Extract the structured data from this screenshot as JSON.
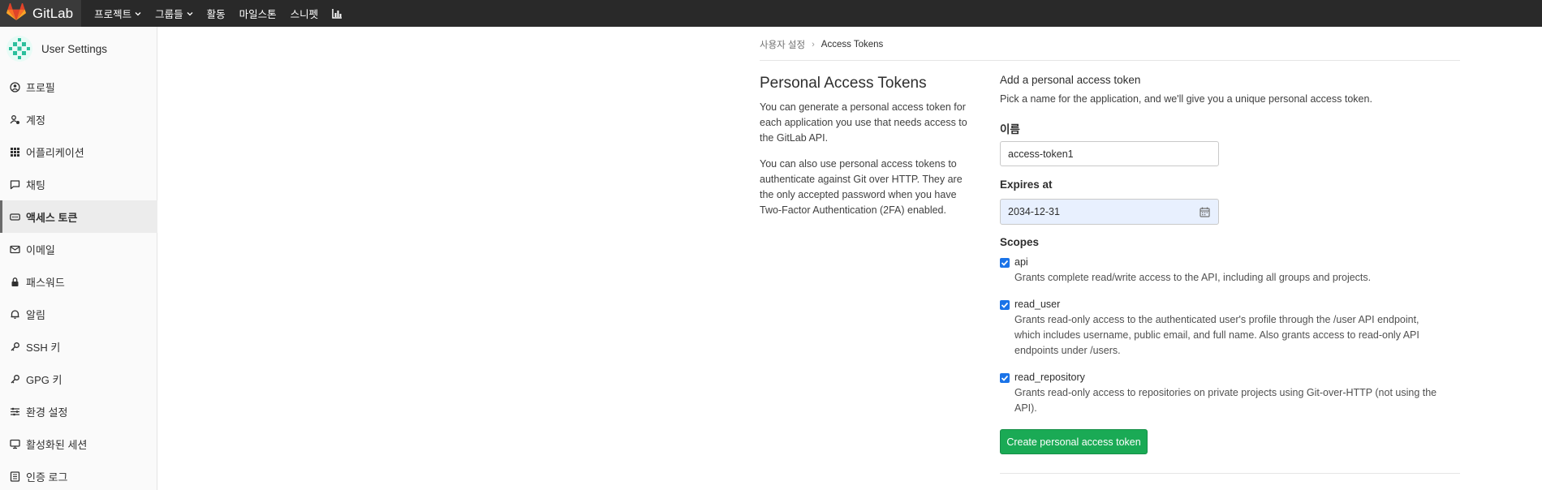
{
  "navbar": {
    "brand": "GitLab",
    "items": [
      {
        "label": "프로젝트",
        "dropdown": true
      },
      {
        "label": "그룹들",
        "dropdown": true
      },
      {
        "label": "활동",
        "dropdown": false
      },
      {
        "label": "마일스톤",
        "dropdown": false
      },
      {
        "label": "스니펫",
        "dropdown": false
      }
    ],
    "chart_icon": "chart-icon"
  },
  "sidebar": {
    "title": "User Settings",
    "items": [
      {
        "label": "프로필",
        "icon": "profile-icon"
      },
      {
        "label": "계정",
        "icon": "account-icon"
      },
      {
        "label": "어플리케이션",
        "icon": "applications-icon"
      },
      {
        "label": "채팅",
        "icon": "chat-icon"
      },
      {
        "label": "액세스 토큰",
        "icon": "token-icon",
        "active": true
      },
      {
        "label": "이메일",
        "icon": "email-icon"
      },
      {
        "label": "패스워드",
        "icon": "lock-icon"
      },
      {
        "label": "알림",
        "icon": "bell-icon"
      },
      {
        "label": "SSH 키",
        "icon": "key-icon"
      },
      {
        "label": "GPG 키",
        "icon": "key-icon"
      },
      {
        "label": "환경 설정",
        "icon": "preferences-icon"
      },
      {
        "label": "활성화된 세션",
        "icon": "monitor-icon"
      },
      {
        "label": "인증 로그",
        "icon": "log-icon"
      }
    ]
  },
  "breadcrumb": {
    "parent": "사용자 설정",
    "separator": "›",
    "current": "Access Tokens"
  },
  "intro": {
    "title": "Personal Access Tokens",
    "paragraph1": "You can generate a personal access token for each application you use that needs access to the GitLab API.",
    "paragraph2": "You can also use personal access tokens to authenticate against Git over HTTP. They are the only accepted password when you have Two-Factor Authentication (2FA) enabled."
  },
  "form": {
    "heading": "Add a personal access token",
    "help": "Pick a name for the application, and we'll give you a unique personal access token.",
    "name_label": "이름",
    "name_value": "access-token1",
    "expires_label": "Expires at",
    "expires_value": "2034-12-31",
    "scopes_label": "Scopes",
    "scopes": [
      {
        "name": "api",
        "checked": true,
        "description": "Grants complete read/write access to the API, including all groups and projects."
      },
      {
        "name": "read_user",
        "checked": true,
        "description": "Grants read-only access to the authenticated user's profile through the /user API endpoint, which includes username, public email, and full name. Also grants access to read-only API endpoints under /users."
      },
      {
        "name": "read_repository",
        "checked": true,
        "description": "Grants read-only access to repositories on private projects using Git-over-HTTP (not using the API)."
      }
    ],
    "submit_label": "Create personal access token"
  },
  "colors": {
    "navbar_bg": "#292929",
    "submit_bg": "#1aaa55",
    "checkbox": "#1a73e8",
    "date_field_bg": "#e8f0fe"
  }
}
